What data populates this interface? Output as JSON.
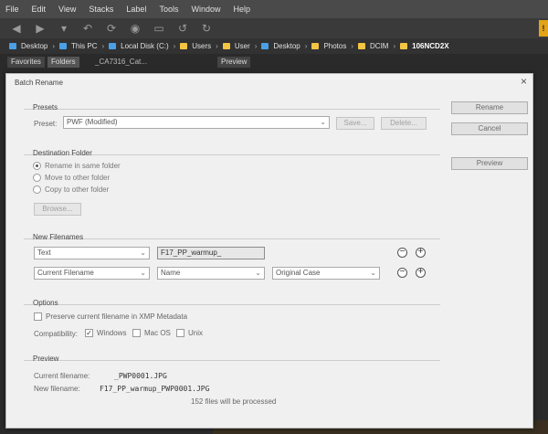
{
  "menu": [
    "File",
    "Edit",
    "View",
    "Stacks",
    "Label",
    "Tools",
    "Window",
    "Help"
  ],
  "toolbar_icons": [
    "back-icon",
    "forward-icon",
    "dropdown-icon",
    "reveal-icon",
    "refresh-icon",
    "boomerang-icon",
    "camera-icon",
    "output-icon",
    "rotate-left-icon",
    "rotate-right-icon"
  ],
  "warning_badge": "!",
  "path": [
    "Desktop",
    "This PC",
    "Local Disk (C:)",
    "Users",
    "User",
    "Desktop",
    "Photos",
    "DCIM",
    "106NCD2X"
  ],
  "panel_tabs": {
    "favorites": "Favorites",
    "folders": "Folders",
    "preview": "Preview",
    "file": "_CA7316_Cat..."
  },
  "dialog": {
    "title": "Batch Rename",
    "close": "×",
    "buttons": {
      "rename": "Rename",
      "cancel": "Cancel",
      "preview": "Preview"
    },
    "presets": {
      "title": "Presets",
      "label": "Preset:",
      "value": "PWF (Modified)",
      "save": "Save...",
      "delete": "Delete..."
    },
    "destination": {
      "title": "Destination Folder",
      "options": [
        "Rename in same folder",
        "Move to other folder",
        "Copy to other folder"
      ],
      "browse": "Browse..."
    },
    "new_filenames": {
      "title": "New Filenames",
      "row1": {
        "type": "Text",
        "value": "F17_PP_warmup_"
      },
      "row2": {
        "type": "Current Filename",
        "part": "Name",
        "case": "Original Case"
      },
      "minus": "−",
      "plus": "+"
    },
    "options": {
      "title": "Options",
      "preserve": "Preserve current filename in XMP Metadata",
      "compat_label": "Compatibility:",
      "windows": "Windows",
      "macos": "Mac OS",
      "unix": "Unix",
      "windows_check": "✓"
    },
    "preview": {
      "title": "Preview",
      "current_label": "Current filename:",
      "current_value": "_PWP0001.JPG",
      "new_label": "New filename:",
      "new_value": "F17_PP_warmup_PWP0001.JPG",
      "count": "152 files will be processed"
    }
  }
}
